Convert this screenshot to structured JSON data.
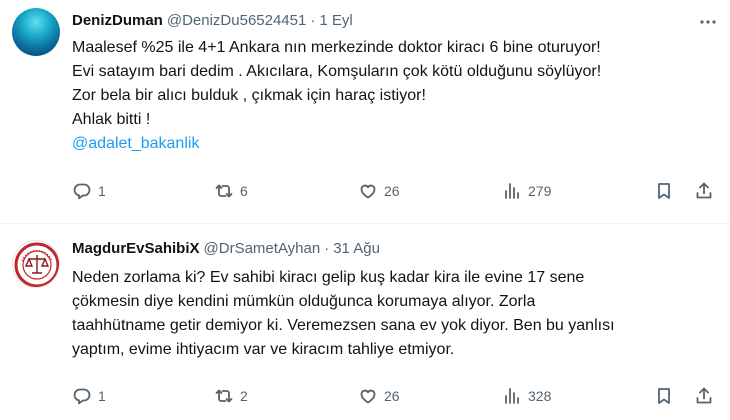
{
  "tweets": [
    {
      "author_name": "DenizDuman",
      "handle": "@DenizDu56524451",
      "separator": "·",
      "date": "1 Eyl",
      "lines": [
        "Maalesef %25 ile 4+1 Ankara nın merkezinde doktor kiracı 6 bine oturuyor!",
        "Evi satayım bari dedim . Akıcılara, Komşuların çok kötü olduğunu söylüyor!",
        "Zor bela bir alıcı bulduk , çıkmak için haraç istiyor!",
        "Ahlak bitti !"
      ],
      "mention": "@adalet_bakanlik",
      "replies": "1",
      "retweets": "6",
      "likes": "26",
      "views": "279"
    },
    {
      "author_name": "MagdurEvSahibiX",
      "handle": "@DrSametAyhan",
      "separator": "·",
      "date": "31 Ağu",
      "lines": [
        "Neden zorlama ki? Ev sahibi kiracı gelip kuş kadar kira ile evine 17 sene",
        "çökmesin diye kendini mümkün olduğunca korumaya alıyor. Zorla",
        "taahhütname getir demiyor ki. Veremezsen sana ev yok diyor. Ben bu yanlısı",
        "yaptım, evime ihtiyacım var ve kiracım tahliye etmiyor."
      ],
      "replies": "1",
      "retweets": "2",
      "likes": "26",
      "views": "328"
    }
  ],
  "colors": {
    "text": "#0f1419",
    "secondary": "#536471",
    "link": "#1d9bf0",
    "divider": "#eff3f4"
  },
  "icons": [
    "more-icon",
    "reply-icon",
    "retweet-icon",
    "like-icon",
    "views-icon",
    "bookmark-icon",
    "share-icon"
  ]
}
